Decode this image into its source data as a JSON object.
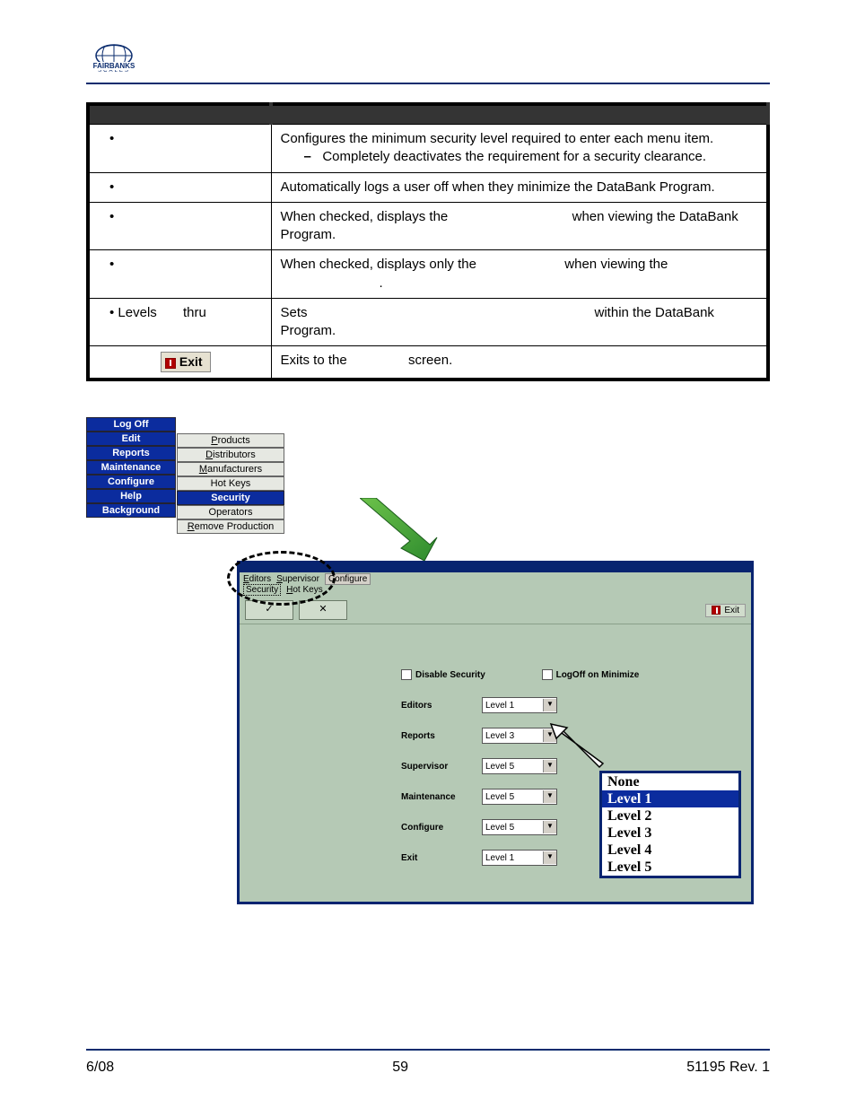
{
  "logo": {
    "name": "FAIRBANKS",
    "sub": "SCALES"
  },
  "table": {
    "rows": [
      {
        "label_html": "•",
        "desc_html": "Configures the minimum security level required to enter each menu item.<br><span style='display:inline-block;width:26px'></span><span class='dash'>–</span>&nbsp;&nbsp;&nbsp;Completely deactivates the requirement for a security clearance."
      },
      {
        "label_html": "•",
        "desc_html": "Automatically logs a user off when they minimize the DataBank Program."
      },
      {
        "label_html": "•",
        "desc_html": "When checked, displays the <span style='display:inline-block;width:130px'></span> when viewing the DataBank Program."
      },
      {
        "label_html": "•",
        "desc_html": "When checked, displays only the <span style='display:inline-block;width:90px'></span> when viewing the<br><span style='display:inline-block;width:110px'></span>."
      },
      {
        "label_html": "• Levels&nbsp;&nbsp;&nbsp;&nbsp;&nbsp;&nbsp;&nbsp;thru",
        "desc_html": "Sets<span style='display:inline-block;width:320px'></span>within the DataBank Program."
      },
      {
        "label_html": "<span class='exit-img'><span class='exit-sq'></span>Exit</span>",
        "desc_html": "Exits to the <span style='display:inline-block;width:60px'></span> screen.",
        "center": true
      }
    ]
  },
  "main_menu": [
    "Log Off",
    "Edit",
    "Reports",
    "Maintenance",
    "Configure",
    "Help",
    "Background"
  ],
  "sub_menu": [
    {
      "t": "Products",
      "u": 0
    },
    {
      "t": "Distributors",
      "u": 0
    },
    {
      "t": "Manufacturers",
      "u": 0
    },
    {
      "t": "Hot Keys",
      "u": -1
    },
    {
      "t": "Security",
      "u": -1,
      "hl": true
    },
    {
      "t": "Operators",
      "u": -1
    },
    {
      "t": "Remove Production",
      "u": 0
    }
  ],
  "win": {
    "menu_row1": [
      "Editors",
      "Supervisor",
      "Configure"
    ],
    "menu_row2": [
      "Security",
      "Hot Keys"
    ],
    "exit": "Exit",
    "chk1": "Disable Security",
    "chk2": "LogOff on Minimize",
    "fields": [
      {
        "label": "Editors",
        "value": "Level 1"
      },
      {
        "label": "Reports",
        "value": "Level 3"
      },
      {
        "label": "Supervisor",
        "value": "Level 5"
      },
      {
        "label": "Maintenance",
        "value": "Level 5"
      },
      {
        "label": "Configure",
        "value": "Level 5"
      },
      {
        "label": "Exit",
        "value": "Level 1"
      }
    ]
  },
  "listbox": [
    "None",
    "Level 1",
    "Level 2",
    "Level 3",
    "Level 4",
    "Level 5"
  ],
  "listbox_selected": 1,
  "footer": {
    "left": "6/08",
    "center": "59",
    "right": "51195    Rev. 1"
  }
}
